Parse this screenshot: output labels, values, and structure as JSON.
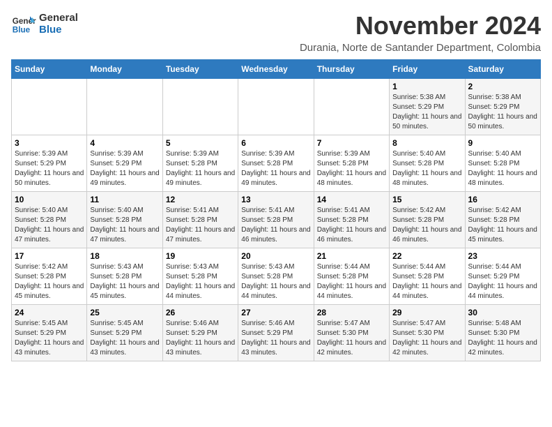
{
  "logo": {
    "line1": "General",
    "line2": "Blue"
  },
  "header": {
    "month_title": "November 2024",
    "subtitle": "Durania, Norte de Santander Department, Colombia"
  },
  "weekdays": [
    "Sunday",
    "Monday",
    "Tuesday",
    "Wednesday",
    "Thursday",
    "Friday",
    "Saturday"
  ],
  "weeks": [
    [
      {
        "day": "",
        "info": ""
      },
      {
        "day": "",
        "info": ""
      },
      {
        "day": "",
        "info": ""
      },
      {
        "day": "",
        "info": ""
      },
      {
        "day": "",
        "info": ""
      },
      {
        "day": "1",
        "info": "Sunrise: 5:38 AM\nSunset: 5:29 PM\nDaylight: 11 hours and 50 minutes."
      },
      {
        "day": "2",
        "info": "Sunrise: 5:38 AM\nSunset: 5:29 PM\nDaylight: 11 hours and 50 minutes."
      }
    ],
    [
      {
        "day": "3",
        "info": "Sunrise: 5:39 AM\nSunset: 5:29 PM\nDaylight: 11 hours and 50 minutes."
      },
      {
        "day": "4",
        "info": "Sunrise: 5:39 AM\nSunset: 5:29 PM\nDaylight: 11 hours and 49 minutes."
      },
      {
        "day": "5",
        "info": "Sunrise: 5:39 AM\nSunset: 5:28 PM\nDaylight: 11 hours and 49 minutes."
      },
      {
        "day": "6",
        "info": "Sunrise: 5:39 AM\nSunset: 5:28 PM\nDaylight: 11 hours and 49 minutes."
      },
      {
        "day": "7",
        "info": "Sunrise: 5:39 AM\nSunset: 5:28 PM\nDaylight: 11 hours and 48 minutes."
      },
      {
        "day": "8",
        "info": "Sunrise: 5:40 AM\nSunset: 5:28 PM\nDaylight: 11 hours and 48 minutes."
      },
      {
        "day": "9",
        "info": "Sunrise: 5:40 AM\nSunset: 5:28 PM\nDaylight: 11 hours and 48 minutes."
      }
    ],
    [
      {
        "day": "10",
        "info": "Sunrise: 5:40 AM\nSunset: 5:28 PM\nDaylight: 11 hours and 47 minutes."
      },
      {
        "day": "11",
        "info": "Sunrise: 5:40 AM\nSunset: 5:28 PM\nDaylight: 11 hours and 47 minutes."
      },
      {
        "day": "12",
        "info": "Sunrise: 5:41 AM\nSunset: 5:28 PM\nDaylight: 11 hours and 47 minutes."
      },
      {
        "day": "13",
        "info": "Sunrise: 5:41 AM\nSunset: 5:28 PM\nDaylight: 11 hours and 46 minutes."
      },
      {
        "day": "14",
        "info": "Sunrise: 5:41 AM\nSunset: 5:28 PM\nDaylight: 11 hours and 46 minutes."
      },
      {
        "day": "15",
        "info": "Sunrise: 5:42 AM\nSunset: 5:28 PM\nDaylight: 11 hours and 46 minutes."
      },
      {
        "day": "16",
        "info": "Sunrise: 5:42 AM\nSunset: 5:28 PM\nDaylight: 11 hours and 45 minutes."
      }
    ],
    [
      {
        "day": "17",
        "info": "Sunrise: 5:42 AM\nSunset: 5:28 PM\nDaylight: 11 hours and 45 minutes."
      },
      {
        "day": "18",
        "info": "Sunrise: 5:43 AM\nSunset: 5:28 PM\nDaylight: 11 hours and 45 minutes."
      },
      {
        "day": "19",
        "info": "Sunrise: 5:43 AM\nSunset: 5:28 PM\nDaylight: 11 hours and 44 minutes."
      },
      {
        "day": "20",
        "info": "Sunrise: 5:43 AM\nSunset: 5:28 PM\nDaylight: 11 hours and 44 minutes."
      },
      {
        "day": "21",
        "info": "Sunrise: 5:44 AM\nSunset: 5:28 PM\nDaylight: 11 hours and 44 minutes."
      },
      {
        "day": "22",
        "info": "Sunrise: 5:44 AM\nSunset: 5:28 PM\nDaylight: 11 hours and 44 minutes."
      },
      {
        "day": "23",
        "info": "Sunrise: 5:44 AM\nSunset: 5:29 PM\nDaylight: 11 hours and 44 minutes."
      }
    ],
    [
      {
        "day": "24",
        "info": "Sunrise: 5:45 AM\nSunset: 5:29 PM\nDaylight: 11 hours and 43 minutes."
      },
      {
        "day": "25",
        "info": "Sunrise: 5:45 AM\nSunset: 5:29 PM\nDaylight: 11 hours and 43 minutes."
      },
      {
        "day": "26",
        "info": "Sunrise: 5:46 AM\nSunset: 5:29 PM\nDaylight: 11 hours and 43 minutes."
      },
      {
        "day": "27",
        "info": "Sunrise: 5:46 AM\nSunset: 5:29 PM\nDaylight: 11 hours and 43 minutes."
      },
      {
        "day": "28",
        "info": "Sunrise: 5:47 AM\nSunset: 5:30 PM\nDaylight: 11 hours and 42 minutes."
      },
      {
        "day": "29",
        "info": "Sunrise: 5:47 AM\nSunset: 5:30 PM\nDaylight: 11 hours and 42 minutes."
      },
      {
        "day": "30",
        "info": "Sunrise: 5:48 AM\nSunset: 5:30 PM\nDaylight: 11 hours and 42 minutes."
      }
    ]
  ]
}
